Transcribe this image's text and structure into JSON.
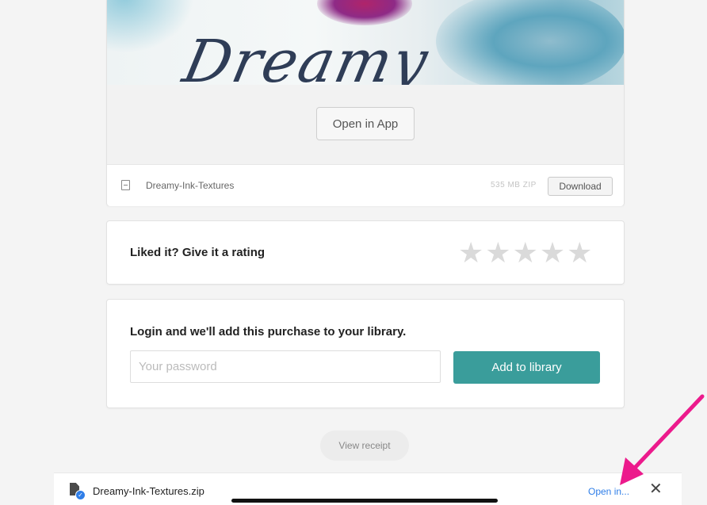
{
  "product": {
    "hero_word": "Dreamy",
    "open_in_app_label": "Open in App",
    "file_name": "Dreamy-Ink-Textures",
    "file_size": "535 MB ZIP",
    "download_label": "Download"
  },
  "rating": {
    "label": "Liked it? Give it a rating",
    "star_count": 5,
    "selected_stars": 0
  },
  "login": {
    "label": "Login and we'll add this purchase to your library.",
    "password_placeholder": "Your password",
    "password_value": "",
    "add_button_label": "Add to library"
  },
  "view_receipt_label": "View receipt",
  "download_bar": {
    "file_name": "Dreamy-Ink-Textures.zip",
    "open_in_label": "Open in...",
    "close_icon": "close-icon"
  },
  "colors": {
    "accent_teal": "#3a9d9b",
    "link_blue": "#2f7ee8",
    "annotation_arrow": "#ec1a8c",
    "star_empty": "#dadada"
  }
}
